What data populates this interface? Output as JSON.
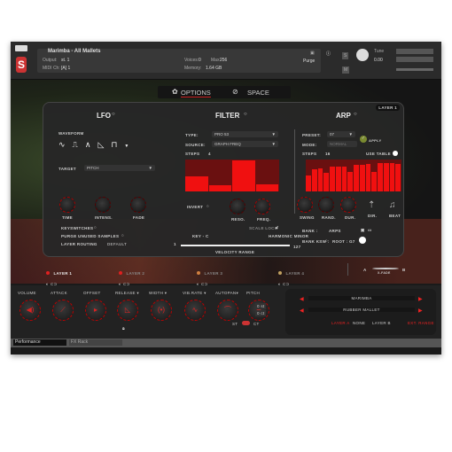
{
  "header": {
    "instrument": "Marimba - All Mallets",
    "output_label": "Output:",
    "output_value": "st. 1",
    "midi_label": "MIDI Ch:",
    "midi_value": "[A] 1",
    "voices_label": "Voices:",
    "voices_value": "0",
    "max_label": "Max:",
    "max_value": "256",
    "memory_label": "Memory:",
    "memory_value": "1.64 GB",
    "purge": "Purge",
    "tune_label": "Tune",
    "tune_value": "0.00",
    "s_btn": "S",
    "m_btn": "M"
  },
  "tabs": {
    "options": "OPTIONS",
    "space": "SPACE"
  },
  "panel": {
    "layer_badge": "LAYER 1",
    "lfo": {
      "title": "LFO",
      "waveform_label": "WAVEFORM",
      "waveforms": [
        "sine",
        "square",
        "triangle",
        "saw",
        "random"
      ],
      "target_label": "TARGET",
      "target_value": "PITCH",
      "knobs": [
        "TIME",
        "INTENS.",
        "FADE"
      ],
      "keyswitches": "KEYSWITCHES",
      "purge_unused": "PURGE UNUSED SAMPLES",
      "layer_routing": "LAYER ROUTING",
      "layer_routing_value": "DEFAULT"
    },
    "filter": {
      "title": "FILTER",
      "type_label": "TYPE:",
      "type_value": "PRO 53",
      "source_label": "SOURCE:",
      "source_value": "GRAPH FREQ",
      "steps_label": "STEPS",
      "steps_value": "4",
      "step_values": [
        0.48,
        0.2,
        0.97,
        0.22
      ],
      "invert": "INVERT",
      "knobs": [
        "RESO.",
        "FREQ."
      ],
      "scale_lock": "SCALE LOCK",
      "key_value": "KEY - C",
      "scale_value": "HARMONIC MINOR",
      "vel_min": "1",
      "vel_max": "127",
      "velocity_range": "VELOCITY RANGE"
    },
    "arp": {
      "title": "ARP",
      "preset_label": "PRESET:",
      "preset_value": "07",
      "mode_label": "MODE:",
      "mode_value": "NORMAL",
      "apply": "APPLY",
      "steps_label": "STEPS",
      "steps_value": "16",
      "use_table": "USE TABLE",
      "step_values": [
        0.5,
        0.7,
        0.72,
        0.58,
        0.77,
        0.78,
        0.77,
        0.6,
        0.83,
        0.84,
        0.86,
        0.6,
        0.9,
        0.9,
        0.88,
        0.86
      ],
      "knobs": [
        "SWING",
        "RAND.",
        "DUR."
      ],
      "dir": "DIR.",
      "beat": "BEAT",
      "bank_label": "BANK :",
      "bank_value": "ARPS",
      "bank_ksw": "BANK KSW :",
      "root_label": "ROOT :",
      "root_value": "G7"
    }
  },
  "layers": [
    {
      "label": "LAYER 1",
      "dot": "#e02020",
      "active": true
    },
    {
      "label": "LAYER 2",
      "dot": "#e02020"
    },
    {
      "label": "LAYER 3",
      "dot": "#d08040"
    },
    {
      "label": "LAYER 4",
      "dot": "#c0a060"
    }
  ],
  "xfade": {
    "a": "A",
    "label": "X-FADE",
    "b": "B"
  },
  "controls": [
    "VOLUME",
    "ATTACK",
    "OFFSET",
    "RELEASE ▾",
    "WIDTH ▾",
    "VIB.RATE ▾",
    "AUTOPAN▾",
    "PITCH"
  ],
  "pitch": {
    "st_value": "0 st",
    "ct_value": "0 ct",
    "st": "ST",
    "ct": "CT"
  },
  "sound": {
    "instrument": "MARIMBA",
    "mallet": "RUBBER MALLET",
    "layer_a": "LAYER A",
    "none": "NONE",
    "layer_b": "LAYER B",
    "ext_range": "EXT. RANGE"
  },
  "bottom_tabs": [
    "Performance",
    "FX Rack"
  ]
}
